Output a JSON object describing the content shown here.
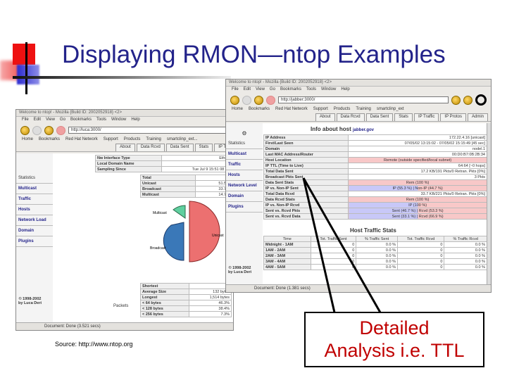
{
  "slide": {
    "title": "Displaying RMON—ntop Examples",
    "source": "Source: http://www.ntop.org",
    "callout_line1": "Detailed",
    "callout_line2": "Analysis i.e. TTL",
    "callout_color": "#c00000",
    "title_color": "#23238a"
  },
  "left_window": {
    "title": "Welcome to ntop! - Mozilla {Build ID: 2002052918} <2>",
    "menu": [
      "File",
      "Edit",
      "View",
      "Go",
      "Bookmarks",
      "Tools",
      "Window",
      "Help"
    ],
    "url": "http://luca:3000/",
    "bookmarks": [
      "Home",
      "Bookmarks",
      "Red Hat Network",
      "Support",
      "Products",
      "Training",
      "smartclinp_ext..."
    ],
    "tabs": [
      "About",
      "Data Rcvd",
      "Data Sent",
      "Stats",
      "IP T"
    ],
    "sidebar": [
      "Statistics",
      "Multicast",
      "Traffic",
      "Hosts",
      "Network Load",
      "Domain",
      "Plugins"
    ],
    "info_rows": [
      [
        "Nw Interface Type",
        "Ethernet"
      ],
      [
        "Local Domain Name",
        "nt"
      ],
      [
        "Sampling Since",
        "Tue Jul 9 15:51 08 2002"
      ]
    ],
    "traffic_rows": [
      [
        "Total",
        ""
      ],
      [
        "Unicast",
        "51.5%"
      ],
      [
        "Broadcast",
        "33.7%"
      ],
      [
        "Multicast",
        "14.7%"
      ]
    ],
    "pie_labels": [
      "Multicast",
      "Unicast",
      "Broadcast"
    ],
    "packet_label": "Packets",
    "size_rows": [
      [
        "Shortest",
        "33"
      ],
      [
        "Average Size",
        "132 bytes"
      ],
      [
        "Longest",
        "1,514 bytes"
      ],
      [
        "< 64 bytes",
        "46.3%"
      ],
      [
        "< 128 bytes",
        "38.4%"
      ],
      [
        "< 256 bytes",
        "7.3%"
      ]
    ],
    "copyright": "© 1998-2002",
    "author": "by Luca Deri",
    "status": "Document: Done (3.521 secs)"
  },
  "right_window": {
    "title": "Welcome to ntop! - Mozilla {Build ID: 2002052918} <2>",
    "menu": [
      "File",
      "Edit",
      "View",
      "Go",
      "Bookmarks",
      "Tools",
      "Window",
      "Help"
    ],
    "url": "http://jabber:3000/",
    "bookmarks": [
      "Home",
      "Bookmarks",
      "Red Hat Network",
      "Support",
      "Products",
      "Training",
      "smartclinp_ext"
    ],
    "tabs": [
      "About",
      "Data Rcvd",
      "Data Sent",
      "Stats",
      "IP Traffic",
      "IP Protos",
      "Admin"
    ],
    "heading": "Info about host",
    "host": "jabber.gov",
    "sidebar": [
      "Statistics",
      "Multicast",
      "Traffic",
      "Hosts",
      "Network Level",
      "Domain",
      "Plugins"
    ],
    "rows": [
      [
        "IP Address",
        "172.22.4.16 [unicast]"
      ],
      [
        "First/Last Seen",
        "07/05/02 13:15:02 - 07/05/02 15:15:49 [45 sec]"
      ],
      [
        "Domain",
        "nodel.1"
      ],
      [
        "Last MAC Address/Router",
        "00:D0:B7:0B:2B:34"
      ],
      [
        "Host Location",
        "Remote (outside specified/local subnet)"
      ],
      [
        "IP TTL (Time to Live)",
        "64:64 [~0 hops]"
      ],
      [
        "Total Data Sent",
        "17.2 KB/191 Pkts/0 Retran. Pkts [0%]"
      ],
      [
        "Broadcast Pkts Sent",
        "3 Pkts"
      ],
      [
        "Data Sent Stats",
        "Rem (100 %)"
      ],
      [
        "IP vs. Non-IP Sent",
        "IP (55.3 %) | Non-IP (44.7 %)"
      ],
      [
        "Total Data Rcvd",
        "33.7 KB/221 Pkts/0 Retran. Pkts [0%]"
      ],
      [
        "Data Rcvd Stats",
        "Rem (100 %)"
      ],
      [
        "IP vs. Non-IP Rcvd",
        "IP (100 %)"
      ],
      [
        "Sent vs. Rcvd Pkts",
        "Sent (46.7 %) | Rcvd (53.3 %)"
      ],
      [
        "Sent vs. Rcvd Data",
        "Sent (33.1 %) | Rcvd (66.9 %)"
      ]
    ],
    "traffic_heading": "Host Traffic Stats",
    "traffic_cols": [
      "Time",
      "Tot. Traffic Sent",
      "% Traffic Sent",
      "Tot. Traffic Rcvd",
      "% Traffic Rcvd"
    ],
    "traffic_rows": [
      [
        "Midnight - 1AM",
        "0",
        "0.0 %",
        "0",
        "0.0 %"
      ],
      [
        "1AM - 2AM",
        "0",
        "0.0 %",
        "0",
        "0.0 %"
      ],
      [
        "2AM - 3AM",
        "0",
        "0.0 %",
        "0",
        "0.0 %"
      ],
      [
        "3AM - 4AM",
        "0",
        "0.0 %",
        "0",
        "0.0 %"
      ],
      [
        "4AM - 5AM",
        "0",
        "0.0 %",
        "0",
        "0.0 %"
      ]
    ],
    "copyright": "© 1998-2002",
    "author": "by Luca Deri",
    "status": "Document: Done (1.381 secs)"
  }
}
